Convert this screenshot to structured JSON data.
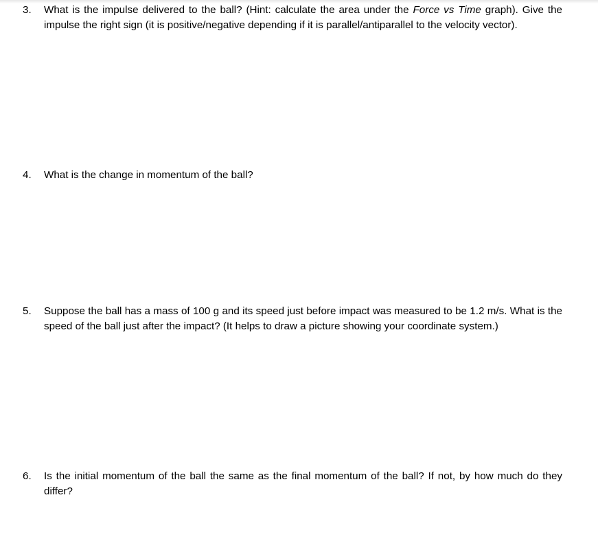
{
  "document": {
    "type": "worksheet-page",
    "background_color": "#ffffff",
    "text_color": "#000000",
    "questions": [
      {
        "number": "3.",
        "text_before_italic": "What is the impulse delivered to the ball? (Hint: calculate the area under the ",
        "italic_phrase": "Force vs Time",
        "text_after_italic": " graph). Give the impulse the right sign (it is positive/negative depending if it is parallel/antiparallel to the velocity vector).",
        "answer_space_height": 196
      },
      {
        "number": "4.",
        "text": "What is the change in momentum of the ball?",
        "answer_space_height": 176
      },
      {
        "number": "5.",
        "text": "Suppose the ball has a mass of 100 g and its speed just before impact was measured to be 1.2 m/s. What is the speed of the ball just after the impact? (It helps to draw a picture showing your coordinate system.)",
        "answer_space_height": 196
      },
      {
        "number": "6.",
        "text": "Is the initial momentum of the ball the same as the final momentum of the ball? If not, by how much do they differ?",
        "answer_space_height": 0
      }
    ]
  }
}
